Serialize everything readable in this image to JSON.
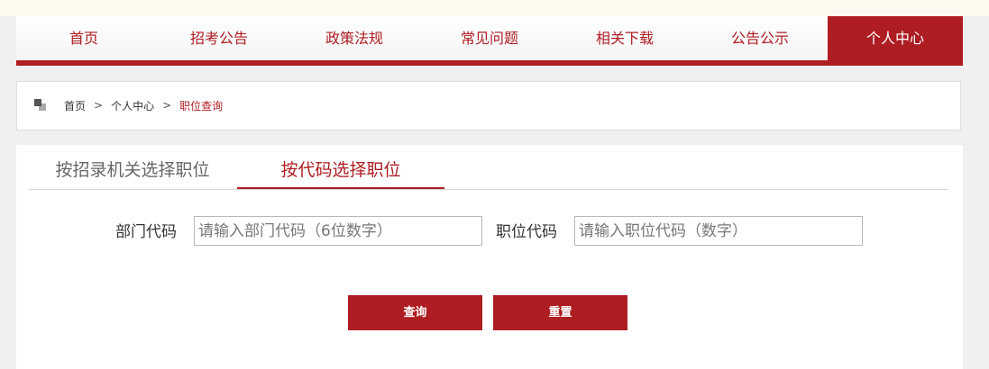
{
  "nav": {
    "items": [
      {
        "label": "首页"
      },
      {
        "label": "招考公告"
      },
      {
        "label": "政策法规"
      },
      {
        "label": "常见问题"
      },
      {
        "label": "相关下载"
      },
      {
        "label": "公告公示"
      },
      {
        "label": "个人中心"
      }
    ],
    "active_index": 6,
    "accent_color": "#ae1d22"
  },
  "breadcrumb": {
    "home": "首页",
    "separator": ">",
    "section": "个人中心",
    "current": "职位查询"
  },
  "tabs": {
    "by_agency": "按招录机关选择职位",
    "by_code": "按代码选择职位"
  },
  "form": {
    "dept_label": "部门代码",
    "dept_placeholder": "请输入部门代码（6位数字）",
    "dept_value": "",
    "position_label": "职位代码",
    "position_placeholder": "请输入职位代码（数字）",
    "position_value": "",
    "query_button": "查询",
    "reset_button": "重置"
  }
}
